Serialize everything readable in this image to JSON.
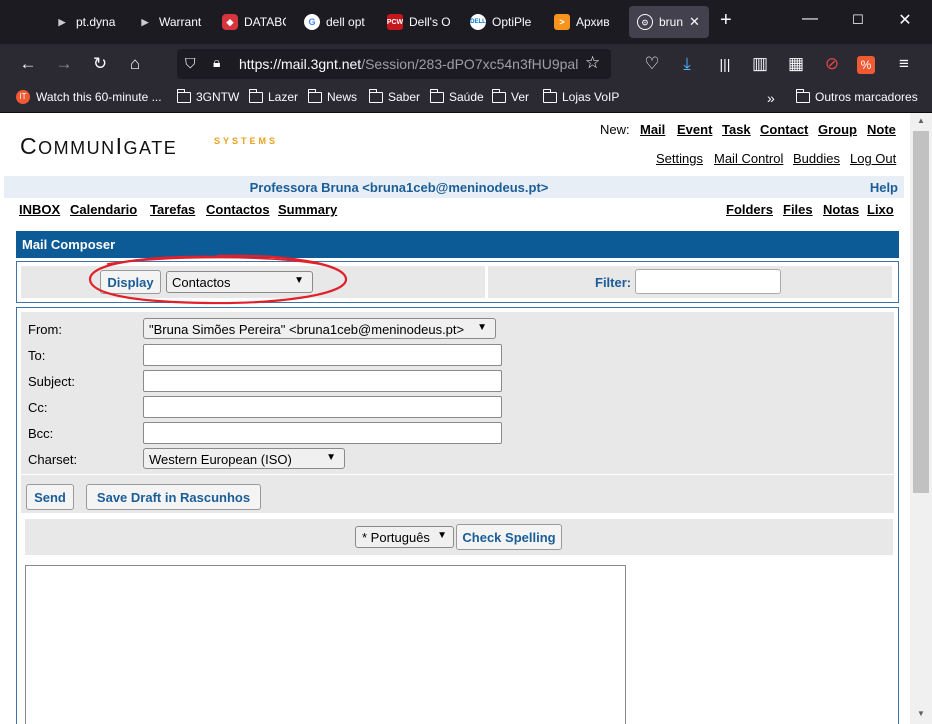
{
  "browser": {
    "tabs": [
      {
        "label": "pt.dyna",
        "icon": "terminal-icon"
      },
      {
        "label": "Warrant",
        "icon": "terminal-icon"
      },
      {
        "label": "DATABC",
        "icon": "shield-icon"
      },
      {
        "label": "dell opt",
        "icon": "google-icon"
      },
      {
        "label": "Dell's O",
        "icon": "pcw-icon"
      },
      {
        "label": "OptiPle",
        "icon": "dell-icon"
      },
      {
        "label": "Архив",
        "icon": "play-icon"
      },
      {
        "label": "brun",
        "icon": "globe-icon"
      }
    ],
    "url_main": "https://mail.3gnt.net",
    "url_rest": "/Session/283-dPO7xc54n3fHU9pal",
    "bookmarks": [
      "Watch this 60-minute ...",
      "3GNTW",
      "Lazer",
      "News",
      "Saber",
      "Saúde",
      "Ver",
      "Lojas VoIP"
    ],
    "other_bookmarks": "Outros marcadores",
    "colors": {
      "tabbar": "#1c1b22",
      "toolbar": "#2b2a33",
      "accent": "#0c5a96"
    }
  },
  "header": {
    "logo_main": "COMMUNIGATE",
    "logo_sub": "SYSTEMS",
    "new_label": "New:",
    "new_links": [
      "Mail",
      "Event",
      "Task",
      "Contact",
      "Group",
      "Note"
    ],
    "util_links": [
      "Settings",
      "Mail Control",
      "Buddies",
      "Log Out"
    ],
    "user": "Professora Bruna <bruna1ceb@meninodeus.pt>",
    "help": "Help",
    "nav_left": [
      "INBOX",
      "Calendario",
      "Tarefas",
      "Contactos",
      "Summary"
    ],
    "nav_right": [
      "Folders",
      "Files",
      "Notas",
      "Lixo"
    ]
  },
  "composer": {
    "title": "Mail Composer",
    "display_button": "Display",
    "display_select": "Contactos",
    "filter_label": "Filter:",
    "filter_value": "",
    "labels": {
      "from": "From:",
      "to": "To:",
      "subject": "Subject:",
      "cc": "Cc:",
      "bcc": "Bcc:",
      "charset": "Charset:"
    },
    "from_value": "\"Bruna Simões Pereira\" <bruna1ceb@meninodeus.pt>",
    "to_value": "",
    "subject_value": "",
    "cc_value": "",
    "bcc_value": "",
    "charset_value": "Western European (ISO)",
    "send_button": "Send",
    "save_draft_button": "Save Draft in Rascunhos",
    "language_select": "* Português",
    "check_spelling_button": "Check Spelling",
    "body_text": ""
  }
}
